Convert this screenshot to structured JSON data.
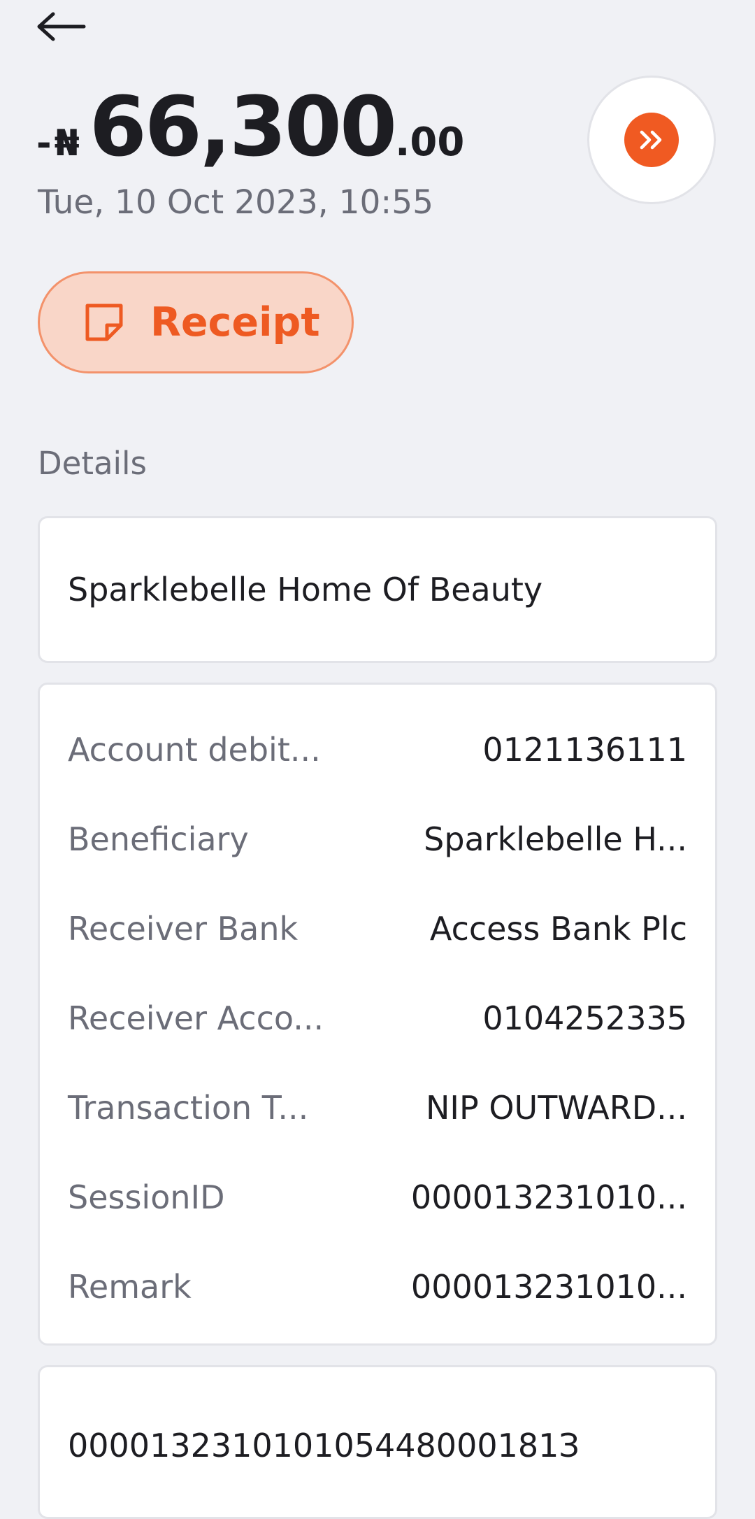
{
  "transaction": {
    "sign": "-",
    "currency_symbol": "₦",
    "amount_whole": "66,300",
    "amount_fraction": ".00",
    "datetime": "Tue, 10 Oct 2023, 10:55"
  },
  "actions": {
    "receipt_label": "Receipt"
  },
  "details": {
    "section_label": "Details",
    "beneficiary_name": "Sparklebelle Home Of Beauty",
    "rows": [
      {
        "label": "Account debit...",
        "value": "0121136111"
      },
      {
        "label": "Beneficiary",
        "value": "Sparklebelle H..."
      },
      {
        "label": "Receiver Bank",
        "value": "Access Bank Plc"
      },
      {
        "label": "Receiver Acco...",
        "value": "0104252335"
      },
      {
        "label": "Transaction T...",
        "value": "NIP OUTWARD..."
      },
      {
        "label": "SessionID",
        "value": "000013231010..."
      },
      {
        "label": "Remark",
        "value": "000013231010..."
      }
    ],
    "reference": "000013231010105448000181З"
  },
  "icons": {
    "back": "arrow-left-icon",
    "share": "double-chevron-right-icon",
    "receipt": "receipt-note-icon"
  },
  "colors": {
    "background": "#f0f1f5",
    "accent": "#f05a22",
    "receipt_fill": "#f9d6c8",
    "muted_text": "#6b6d78"
  }
}
